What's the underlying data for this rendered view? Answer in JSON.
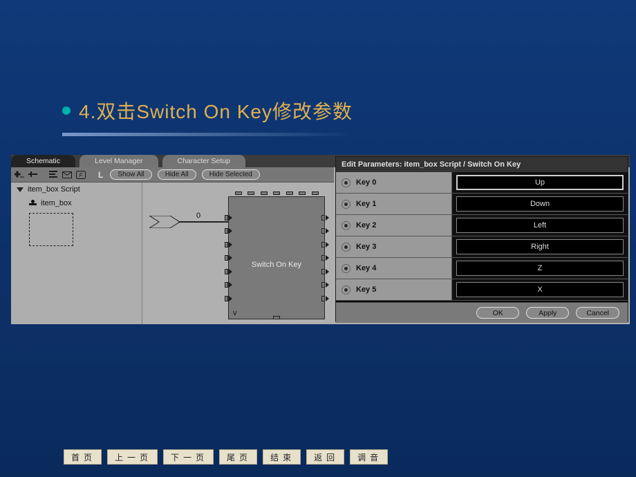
{
  "heading": {
    "text": "4.双击Switch On Key修改参数"
  },
  "tabs": {
    "items": [
      {
        "label": "Schematic"
      },
      {
        "label": "Level Manager"
      },
      {
        "label": "Character Setup"
      }
    ],
    "activeIndex": 0
  },
  "toolbar": {
    "l_label": "L",
    "buttons": {
      "show_all": "Show All",
      "hide_all": "Hide All",
      "hide_selected": "Hide Selected"
    }
  },
  "tree": {
    "root_label": "item_box Script",
    "child_label": "item_box"
  },
  "schematic": {
    "wire_label": "0",
    "node_label": "Switch On Key",
    "node_marker": "v"
  },
  "edit_panel": {
    "title": "Edit Parameters: item_box Script / Switch On Key",
    "rows": [
      {
        "label": "Key 0",
        "value": "Up"
      },
      {
        "label": "Key 1",
        "value": "Down"
      },
      {
        "label": "Key 2",
        "value": "Left"
      },
      {
        "label": "Key 3",
        "value": "Right"
      },
      {
        "label": "Key 4",
        "value": "Z"
      },
      {
        "label": "Key 5",
        "value": "X"
      }
    ],
    "buttons": {
      "ok": "OK",
      "apply": "Apply",
      "cancel": "Cancel"
    }
  },
  "bottom_nav": {
    "buttons": [
      "首页",
      "上一页",
      "下一页",
      "尾页",
      "结束",
      "返回",
      "调音"
    ]
  }
}
